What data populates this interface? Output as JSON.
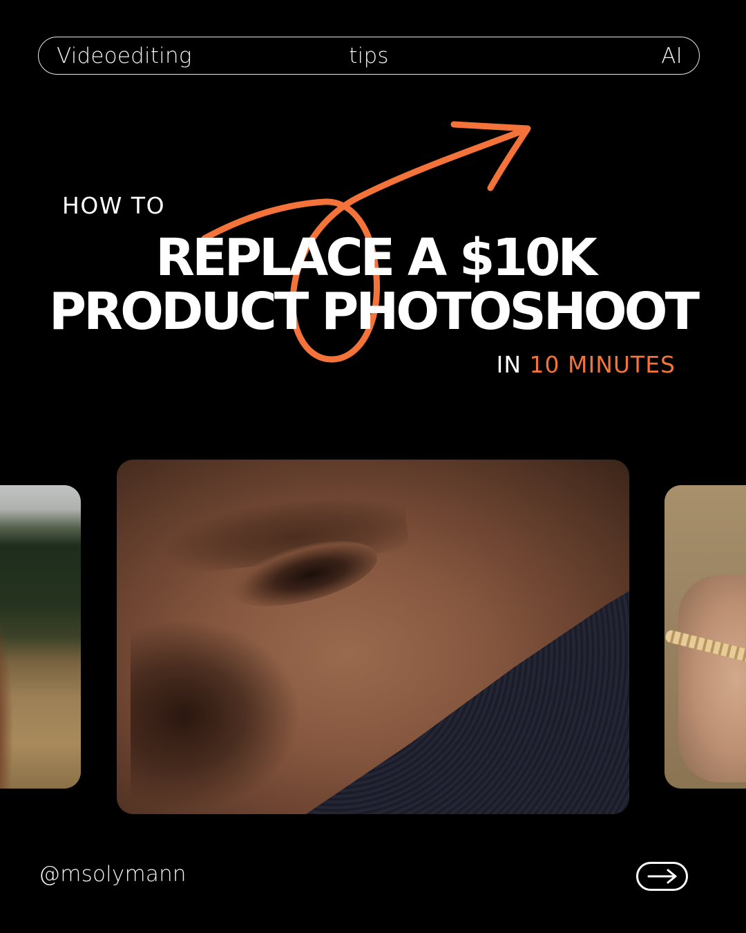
{
  "tags": {
    "left": "Videoediting",
    "center": "tips",
    "right": "AI"
  },
  "headline": {
    "intro": "HOW TO",
    "line1": "REPLACE A $10K",
    "line2": "PRODUCT PHOTOSHOOT",
    "suffix_prefix": "IN",
    "suffix_accent": "10 MINUTES"
  },
  "images": [
    {
      "icon": "photo-woman-field"
    },
    {
      "icon": "photo-woman-closeup"
    },
    {
      "icon": "photo-hand-wheat"
    }
  ],
  "footer": {
    "handle": "@msolymann",
    "next_icon": "arrow-right-icon"
  },
  "colors": {
    "background": "#000000",
    "text": "#ffffff",
    "accent": "#f4733b"
  }
}
